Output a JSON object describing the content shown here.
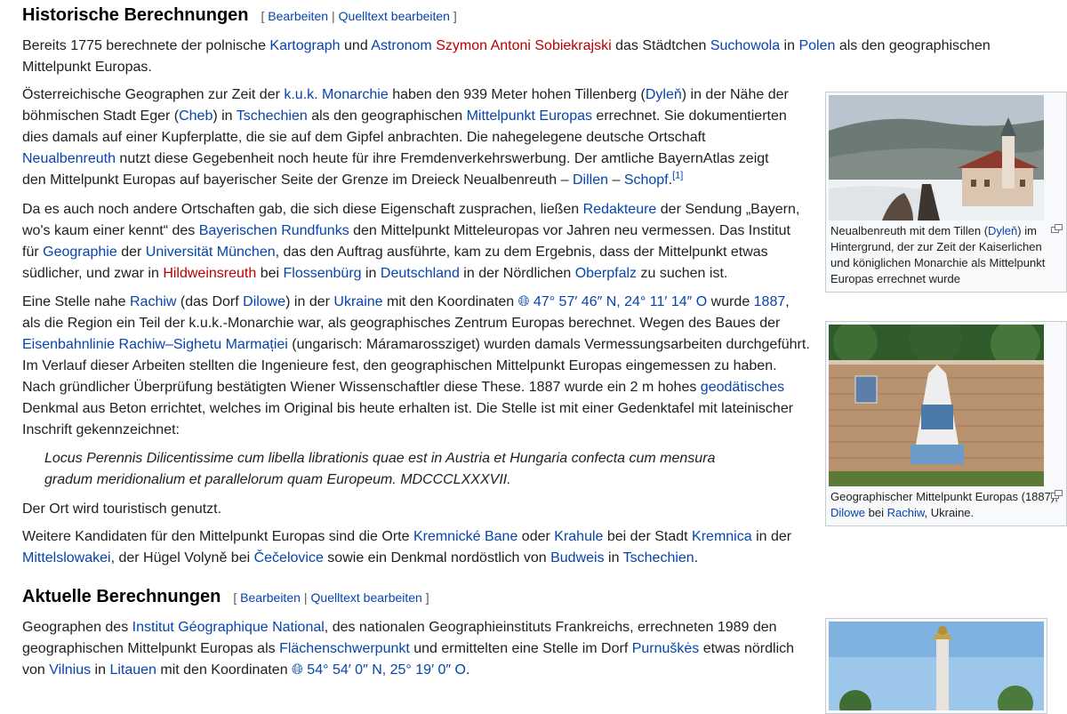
{
  "section1": {
    "title": "Historische Berechnungen",
    "edit": "Bearbeiten",
    "edit_source": "Quelltext bearbeiten"
  },
  "p1": {
    "t1": "Bereits 1775 berechnete der polnische ",
    "l1": "Kartograph",
    "t2": " und ",
    "l2": "Astronom",
    "t3": " ",
    "l3": "Szymon Antoni Sobiekrajski",
    "t4": " das Städtchen ",
    "l4": "Suchowola",
    "t5": " in ",
    "l5": "Polen",
    "t6": " als den geographischen Mittelpunkt Europas."
  },
  "p2": {
    "t1": "Österreichische Geographen zur Zeit der ",
    "l1": "k.u.k. Monarchie",
    "t2": " haben den 939 Meter hohen Tillenberg (",
    "l2": "Dyleň",
    "t3": ") in der Nähe der böhmischen Stadt Eger (",
    "l3": "Cheb",
    "t4": ") in ",
    "l4": "Tschechien",
    "t5": " als den geographischen ",
    "l5": "Mittelpunkt Europas",
    "t6": " errechnet. Sie dokumentierten dies damals auf einer Kupferplatte, die sie auf dem Gipfel anbrachten. Die nahegelegene deutsche Ortschaft ",
    "l6": "Neualbenreuth",
    "t7": " nutzt diese Gegebenheit noch heute für ihre Fremdenverkehrswerbung. Der amtliche BayernAtlas zeigt den Mittelpunkt Europas auf bayerischer Seite der Grenze im Dreieck Neualbenreuth – ",
    "l7": "Dillen",
    "t8": " – ",
    "l8": "Schopf",
    "t9": ".",
    "ref": "[1]"
  },
  "p3": {
    "t1": "Da es auch noch andere Ortschaften gab, die sich diese Eigenschaft zusprachen, ließen ",
    "l1": "Redakteure",
    "t2": " der Sendung „Bayern, wo's kaum einer kennt“ des ",
    "l2": "Bayerischen Rundfunks",
    "t3": " den Mittelpunkt Mitteleuropas vor Jahren neu vermessen. Das Institut für ",
    "l3": "Geographie",
    "t4": " der ",
    "l4": "Universität München",
    "t5": ", das den Auftrag ausführte, kam zu dem Ergebnis, dass der Mittelpunkt etwas südlicher, und zwar in ",
    "l5": "Hildweinsreuth",
    "t6": " bei ",
    "l6": "Flossenbürg",
    "t7": " in ",
    "l7": "Deutschland",
    "t8": " in der Nördlichen ",
    "l8": "Oberpfalz",
    "t9": " zu suchen ist."
  },
  "p4": {
    "t1": "Eine Stelle nahe ",
    "l1": "Rachiw",
    "t2": " (das Dorf ",
    "l2": "Dilowe",
    "t3": ") in der ",
    "l3": "Ukraine",
    "t4": " mit den Koordinaten ",
    "coord": "47° 57′ 46″ N, 24° 11′ 14″ O",
    "t5": " wurde ",
    "l4": "1887",
    "t6": ", als die Region ein Teil der k.u.k.-Monarchie war, als geographisches Zentrum Europas berechnet. Wegen des Baues der ",
    "l5": "Eisenbahnlinie Rachiw–Sighetu Marmației",
    "t7": " (ungarisch: Máramarossziget) wurden damals Vermessungsarbeiten durchgeführt. Im Verlauf dieser Arbeiten stellten die Ingenieure fest, den geographischen Mittelpunkt Europas eingemessen zu haben. Nach gründlicher Überprüfung bestätigten Wiener Wissenschaftler diese These. 1887 wurde ein 2 m hohes ",
    "l6": "geodätisches",
    "t8": " Denkmal aus Beton errichtet, welches im Original bis heute erhalten ist. Die Stelle ist mit einer Gedenktafel mit lateinischer Inschrift gekennzeichnet:"
  },
  "quote": "Locus Perennis Dilicentissime cum libella librationis quae est in Austria et Hungaria confecta cum mensura gradum meridionalium et parallelorum quam Europeum. MDCCCLXXXVII.",
  "p5": "Der Ort wird touristisch genutzt.",
  "p6": {
    "t1": "Weitere Kandidaten für den Mittelpunkt Europas sind die Orte ",
    "l1": "Kremnické Bane",
    "t2": " oder ",
    "l2": "Krahule",
    "t3": " bei der Stadt ",
    "l3": "Kremnica",
    "t4": " in der ",
    "l4": "Mittelslowakei",
    "t5": ", der Hügel Volyně bei ",
    "l5": "Čečelovice",
    "t6": " sowie ein Denkmal nordöstlich von ",
    "l6": "Budweis",
    "t7": " in ",
    "l7": "Tschechien",
    "t8": "."
  },
  "section2": {
    "title": "Aktuelle Berechnungen",
    "edit": "Bearbeiten",
    "edit_source": "Quelltext bearbeiten"
  },
  "p7": {
    "t1": "Geographen des ",
    "l1": "Institut Géographique National",
    "t2": ", des nationalen Geographieinstituts Frankreichs, errechneten 1989 den geographischen Mittelpunkt Europas als ",
    "l2": "Flächenschwerpunkt",
    "t3": " und ermittelten eine Stelle im Dorf ",
    "l3": "Purnuškės",
    "t4": " etwas nördlich von ",
    "l4": "Vilnius",
    "t5": " in ",
    "l5": "Litauen",
    "t6": " mit den Koordinaten ",
    "coord": "54° 54′ 0″ N, 25° 19′ 0″ O",
    "t7": "."
  },
  "thumb1": {
    "cap_t1": "Neualbenreuth mit dem Tillen (",
    "cap_l1": "Dyleň",
    "cap_t2": ") im Hintergrund, der zur Zeit der Kaiserlichen und königlichen Monarchie als Mittelpunkt Europas errechnet wurde"
  },
  "thumb2": {
    "cap_t1": "Geographischer Mittelpunkt Europas (1887), ",
    "cap_l1": "Dilowe",
    "cap_t2": " bei ",
    "cap_l2": "Rachiw",
    "cap_t3": ", Ukraine."
  },
  "globe_icon": "globe-icon",
  "magnify_icon": "magnify-icon",
  "colors": {
    "link": "#0645ad",
    "redlink": "#ba0000",
    "text": "#202122"
  }
}
